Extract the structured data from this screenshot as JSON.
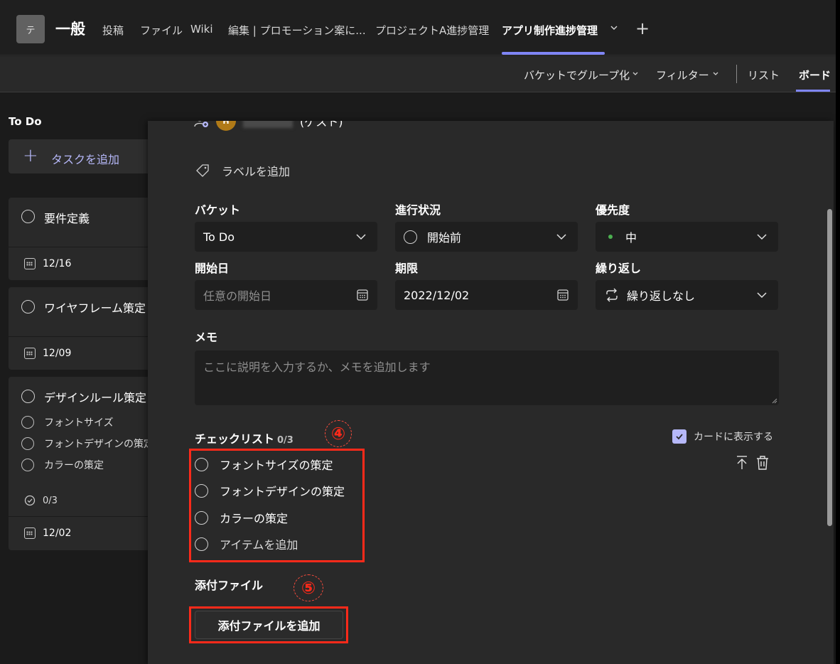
{
  "header": {
    "team_avatar_letter": "テ",
    "channel_name": "一般",
    "tabs": [
      {
        "label": "投稿"
      },
      {
        "label": "ファイル"
      },
      {
        "label": "Wiki"
      },
      {
        "label": "編集 | プロモーション案に..."
      },
      {
        "label": "プロジェクトA進捗管理"
      },
      {
        "label": "アプリ制作進捗管理",
        "active": true
      }
    ],
    "add_tab_symbol": "+"
  },
  "toolbar": {
    "group_by_label": "バケットでグループ化",
    "filter_label": "フィルター",
    "list_label": "リスト",
    "board_label": "ボード"
  },
  "board": {
    "column_title": "To Do",
    "add_task_label": "タスクを追加",
    "cards": [
      {
        "title": "要件定義",
        "date": "12/16"
      },
      {
        "title": "ワイヤフレーム策定",
        "date": "12/09"
      },
      {
        "title": "デザインルール策定",
        "subitems": [
          "フォントサイズ",
          "フォントデザインの策定",
          "カラーの策定"
        ],
        "progress": "0/3",
        "date": "12/02"
      }
    ]
  },
  "panel": {
    "assignee_initial": "H",
    "assignee_suffix": "(ゲスト)",
    "add_label": "ラベルを追加",
    "bucket": {
      "label": "バケット",
      "value": "To Do"
    },
    "status": {
      "label": "進行状況",
      "value": "開始前"
    },
    "priority": {
      "label": "優先度",
      "value": "中",
      "dot_color": "#4caf50"
    },
    "start_date": {
      "label": "開始日",
      "placeholder": "任意の開始日"
    },
    "due_date": {
      "label": "期限",
      "value": "2022/12/02"
    },
    "repeat": {
      "label": "繰り返し",
      "value": "繰り返しなし"
    },
    "memo": {
      "label": "メモ",
      "placeholder": "ここに説明を入力するか、メモを追加します"
    },
    "checklist": {
      "title": "チェックリスト",
      "count": "0/3",
      "show_on_card_label": "カードに表示する",
      "items": [
        "フォントサイズの策定",
        "フォントデザインの策定",
        "カラーの策定"
      ],
      "add_item_label": "アイテムを追加"
    },
    "attachments": {
      "title": "添付ファイル",
      "add_button_label": "添付ファイルを追加"
    },
    "annotations": {
      "four": "④",
      "five": "⑤",
      "color": "#ff2a1a"
    }
  },
  "colors": {
    "accent": "#7f85f5",
    "accent_light": "#b6b8f9",
    "background": "#1f1f1f",
    "panel": "#292929"
  }
}
